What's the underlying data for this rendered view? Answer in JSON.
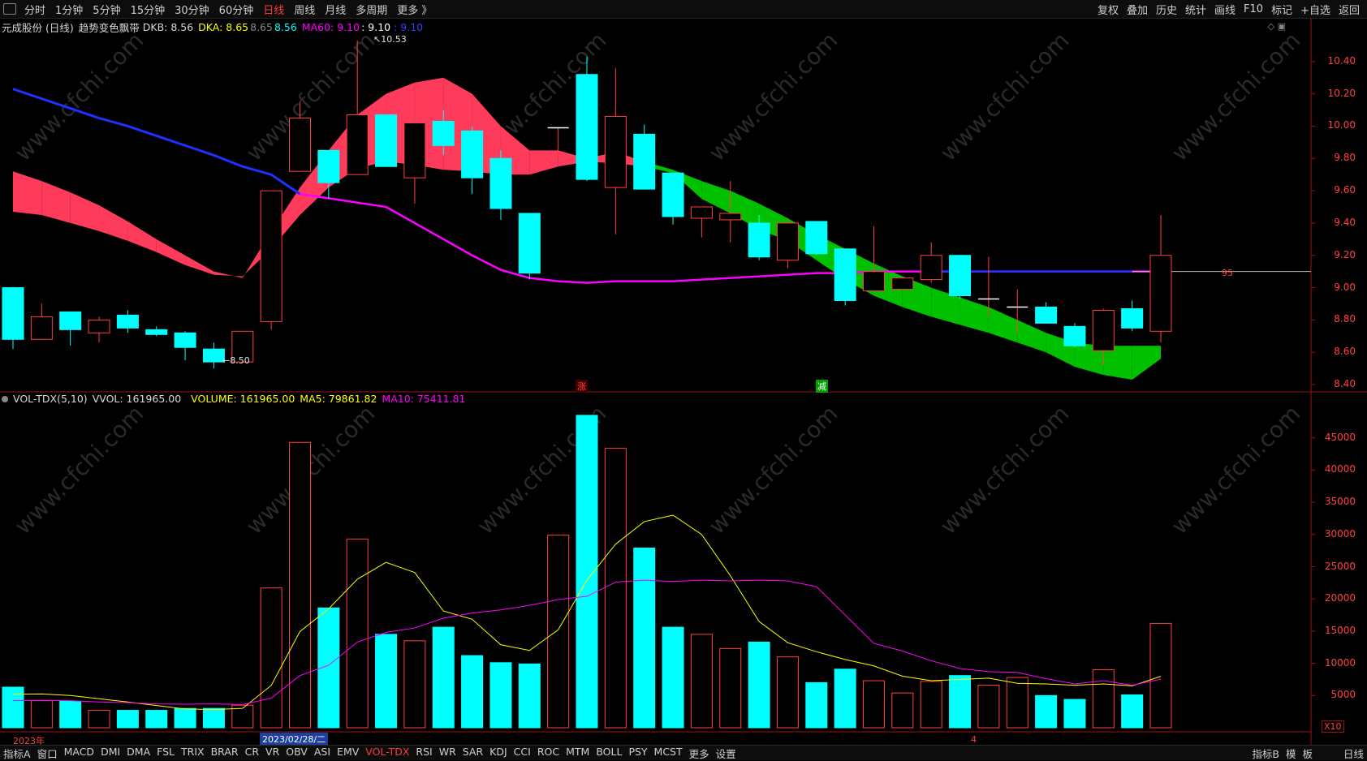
{
  "toolbar": {
    "periods": [
      "分时",
      "1分钟",
      "5分钟",
      "15分钟",
      "30分钟",
      "60分钟",
      "日线",
      "周线",
      "月线",
      "多周期",
      "更多 》"
    ],
    "active_period": "日线",
    "right_buttons": [
      "复权",
      "叠加",
      "历史",
      "统计",
      "画线",
      "F10",
      "标记",
      "+自选",
      "返回"
    ]
  },
  "price_panel": {
    "stock": "元成股份 (日线)",
    "indicator": "趋势变色飘带",
    "dkb_label": "DKB: 8.56",
    "dka_label": "DKA: 8.65",
    "v1": "8.65",
    "v2": "8.56",
    "ma60_label": "MA60: 9.10",
    "v3": ": 9.10",
    "v4": ": 9.10",
    "high_marker": "10.53",
    "low_marker": "8.50",
    "last_tag": "95",
    "signal_up": "涨",
    "signal_down": "减",
    "y_ticks": [
      "10.40",
      "10.20",
      "10.00",
      "9.80",
      "9.60",
      "9.40",
      "9.20",
      "9.00",
      "8.80",
      "8.60",
      "8.40"
    ]
  },
  "volume_panel": {
    "title": "VOL-TDX(5,10)",
    "vvol": "VVOL: 161965.00",
    "volume": "VOLUME: 161965.00",
    "ma5": "MA5: 79861.82",
    "ma10": "MA10: 75411.81",
    "y_ticks": [
      "45000",
      "40000",
      "35000",
      "30000",
      "25000",
      "20000",
      "15000",
      "10000",
      "5000"
    ],
    "unit": "X10"
  },
  "time_axis": {
    "year": "2023年",
    "cursor_date": "2023/02/28/二",
    "month_mark": "4"
  },
  "bottom_tabs": [
    "指标A",
    "窗口",
    "MACD",
    "DMI",
    "DMA",
    "FSL",
    "TRIX",
    "BRAR",
    "CR",
    "VR",
    "OBV",
    "ASI",
    "EMV",
    "VOL-TDX",
    "RSI",
    "WR",
    "SAR",
    "KDJ",
    "CCI",
    "ROC",
    "MTM",
    "BOLL",
    "PSY",
    "MCST",
    "更多",
    "设置"
  ],
  "active_tab": "VOL-TDX",
  "bottom_right": [
    "指标B",
    "模",
    "板",
    "日线"
  ],
  "watermark": "www.cfchi.com",
  "colors": {
    "up": "#ff4040",
    "down": "#00ffff",
    "ma60": "#ff00ff",
    "ribbon_up": "#ff3b5c",
    "ribbon_down": "#00c000",
    "ma5": "#ffff00",
    "ma10": "#ff00ff"
  },
  "chart_data": {
    "type": "candlestick",
    "candles": [
      {
        "o": 9.0,
        "c": 8.68,
        "h": 9.0,
        "l": 8.62,
        "v": 6300
      },
      {
        "o": 8.68,
        "c": 8.82,
        "h": 8.9,
        "l": 8.68,
        "v": 4200
      },
      {
        "o": 8.85,
        "c": 8.74,
        "h": 8.85,
        "l": 8.64,
        "v": 4100
      },
      {
        "o": 8.72,
        "c": 8.8,
        "h": 8.82,
        "l": 8.66,
        "v": 2700
      },
      {
        "o": 8.83,
        "c": 8.75,
        "h": 8.86,
        "l": 8.72,
        "v": 2700
      },
      {
        "o": 8.74,
        "c": 8.71,
        "h": 8.76,
        "l": 8.7,
        "v": 2700
      },
      {
        "o": 8.72,
        "c": 8.63,
        "h": 8.73,
        "l": 8.55,
        "v": 3000
      },
      {
        "o": 8.62,
        "c": 8.54,
        "h": 8.66,
        "l": 8.5,
        "v": 3000
      },
      {
        "o": 8.54,
        "c": 8.73,
        "h": 8.73,
        "l": 8.54,
        "v": 3500
      },
      {
        "o": 8.79,
        "c": 9.6,
        "h": 9.6,
        "l": 8.74,
        "v": 21700
      },
      {
        "o": 9.72,
        "c": 10.05,
        "h": 10.15,
        "l": 9.75,
        "v": 44300
      },
      {
        "o": 9.85,
        "c": 9.65,
        "h": 9.85,
        "l": 9.55,
        "v": 18600
      },
      {
        "o": 9.7,
        "c": 10.07,
        "h": 10.53,
        "l": 9.7,
        "v": 29300
      },
      {
        "o": 10.07,
        "c": 9.75,
        "h": 10.07,
        "l": 9.75,
        "v": 14500
      },
      {
        "o": 9.68,
        "c": 10.02,
        "h": 10.02,
        "l": 9.52,
        "v": 13500
      },
      {
        "o": 10.03,
        "c": 9.88,
        "h": 10.1,
        "l": 9.82,
        "v": 15600
      },
      {
        "o": 9.97,
        "c": 9.68,
        "h": 10.0,
        "l": 9.58,
        "v": 11200
      },
      {
        "o": 9.8,
        "c": 9.49,
        "h": 9.85,
        "l": 9.42,
        "v": 10100
      },
      {
        "o": 9.46,
        "c": 9.09,
        "h": 9.46,
        "l": 9.05,
        "v": 9900
      },
      {
        "o": 9.99,
        "c": 9.99,
        "h": 9.99,
        "l": 9.82,
        "v": 29900
      },
      {
        "o": 10.32,
        "c": 9.67,
        "h": 10.43,
        "l": 9.66,
        "v": 48500
      },
      {
        "o": 9.62,
        "c": 10.06,
        "h": 10.36,
        "l": 9.33,
        "v": 43400
      },
      {
        "o": 9.95,
        "c": 9.61,
        "h": 10.01,
        "l": 9.61,
        "v": 27900
      },
      {
        "o": 9.71,
        "c": 9.44,
        "h": 9.71,
        "l": 9.39,
        "v": 15600
      },
      {
        "o": 9.43,
        "c": 9.5,
        "h": 9.5,
        "l": 9.31,
        "v": 14500
      },
      {
        "o": 9.42,
        "c": 9.46,
        "h": 9.66,
        "l": 9.28,
        "v": 12300
      },
      {
        "o": 9.4,
        "c": 9.19,
        "h": 9.45,
        "l": 9.17,
        "v": 13300
      },
      {
        "o": 9.17,
        "c": 9.4,
        "h": 9.43,
        "l": 9.12,
        "v": 11000
      },
      {
        "o": 9.41,
        "c": 9.21,
        "h": 9.41,
        "l": 9.2,
        "v": 7000
      },
      {
        "o": 9.24,
        "c": 8.92,
        "h": 9.24,
        "l": 8.89,
        "v": 9100
      },
      {
        "o": 8.98,
        "c": 9.1,
        "h": 9.38,
        "l": 8.98,
        "v": 7300
      },
      {
        "o": 8.99,
        "c": 9.06,
        "h": 9.06,
        "l": 8.99,
        "v": 5400
      },
      {
        "o": 9.05,
        "c": 9.2,
        "h": 9.28,
        "l": 9.03,
        "v": 7200
      },
      {
        "o": 9.2,
        "c": 8.95,
        "h": 9.2,
        "l": 8.93,
        "v": 8100
      },
      {
        "o": 8.93,
        "c": 8.93,
        "h": 9.19,
        "l": 8.82,
        "v": 6600
      },
      {
        "o": 8.88,
        "c": 8.88,
        "h": 8.99,
        "l": 8.72,
        "v": 7800
      },
      {
        "o": 8.88,
        "c": 8.78,
        "h": 8.91,
        "l": 8.78,
        "v": 5000
      },
      {
        "o": 8.76,
        "c": 8.64,
        "h": 8.78,
        "l": 8.63,
        "v": 4400
      },
      {
        "o": 8.61,
        "c": 8.86,
        "h": 8.87,
        "l": 8.52,
        "v": 9000
      },
      {
        "o": 8.87,
        "c": 8.75,
        "h": 8.92,
        "l": 8.73,
        "v": 5100
      },
      {
        "o": 8.73,
        "c": 9.2,
        "h": 9.45,
        "l": 8.66,
        "v": 16200
      }
    ],
    "ma60": [
      null,
      null,
      null,
      null,
      null,
      null,
      null,
      null,
      null,
      null,
      null,
      null,
      null,
      9.5,
      9.4,
      9.3,
      9.2,
      9.11,
      9.06,
      9.04,
      9.03,
      9.04,
      9.04,
      9.04,
      9.05,
      9.06,
      9.07,
      9.08,
      9.09,
      9.09,
      9.1,
      9.1,
      9.1,
      9.1,
      9.1,
      9.1,
      9.1,
      9.1,
      9.1,
      9.1,
      9.1
    ],
    "ma60_prev": [
      10.23,
      10.17,
      10.11,
      10.05,
      10.0,
      9.94,
      9.88,
      9.82,
      9.75,
      9.7,
      9.58
    ],
    "ribbon_dka": [
      9.72,
      9.66,
      9.59,
      9.51,
      9.41,
      9.3,
      9.2,
      9.1,
      9.06,
      9.35,
      9.62,
      9.85,
      10.07,
      10.2,
      10.27,
      10.3,
      10.2,
      10.0,
      9.85,
      9.85,
      9.8,
      9.84,
      9.78,
      9.73,
      9.66,
      9.6,
      9.52,
      9.43,
      9.33,
      9.24,
      9.15,
      9.07,
      9.0,
      8.94,
      8.88,
      8.8,
      8.72,
      8.66,
      8.64,
      8.64,
      8.64
    ],
    "ribbon_dkb": [
      9.47,
      9.45,
      9.4,
      9.35,
      9.29,
      9.22,
      9.14,
      9.08,
      9.07,
      9.24,
      9.45,
      9.62,
      9.74,
      9.78,
      9.76,
      9.73,
      9.72,
      9.7,
      9.7,
      9.75,
      9.78,
      9.77,
      9.75,
      9.71,
      9.55,
      9.46,
      9.36,
      9.29,
      9.17,
      9.05,
      8.95,
      8.88,
      8.82,
      8.77,
      8.72,
      8.66,
      8.6,
      8.51,
      8.46,
      8.43,
      8.56
    ],
    "vol_ma5": [
      5200,
      5250,
      5000,
      4500,
      4000,
      3450,
      2920,
      2820,
      3000,
      6570,
      14940,
      18450,
      23060,
      25670,
      24100,
      18120,
      16840,
      12880,
      12000,
      15200,
      22900,
      28500,
      32000,
      33000,
      30000,
      23600,
      16500,
      13200,
      11800,
      10600,
      9600,
      8000,
      7300,
      7500,
      7700,
      6900,
      6800,
      6600,
      6800,
      6500,
      7986
    ],
    "vol_ma10": [
      4200,
      4250,
      4200,
      4000,
      3900,
      3700,
      3650,
      3700,
      3600,
      4600,
      8100,
      9700,
      13300,
      14800,
      15500,
      17000,
      17800,
      18300,
      19000,
      19900,
      20400,
      22600,
      22900,
      22700,
      22900,
      22800,
      22900,
      22800,
      21900,
      17500,
      13100,
      11900,
      10400,
      9200,
      8700,
      8600,
      7600,
      6800,
      7300,
      6600,
      7541
    ],
    "price_ylim": [
      8.38,
      10.58
    ],
    "vol_ylim": [
      0,
      50000
    ]
  }
}
